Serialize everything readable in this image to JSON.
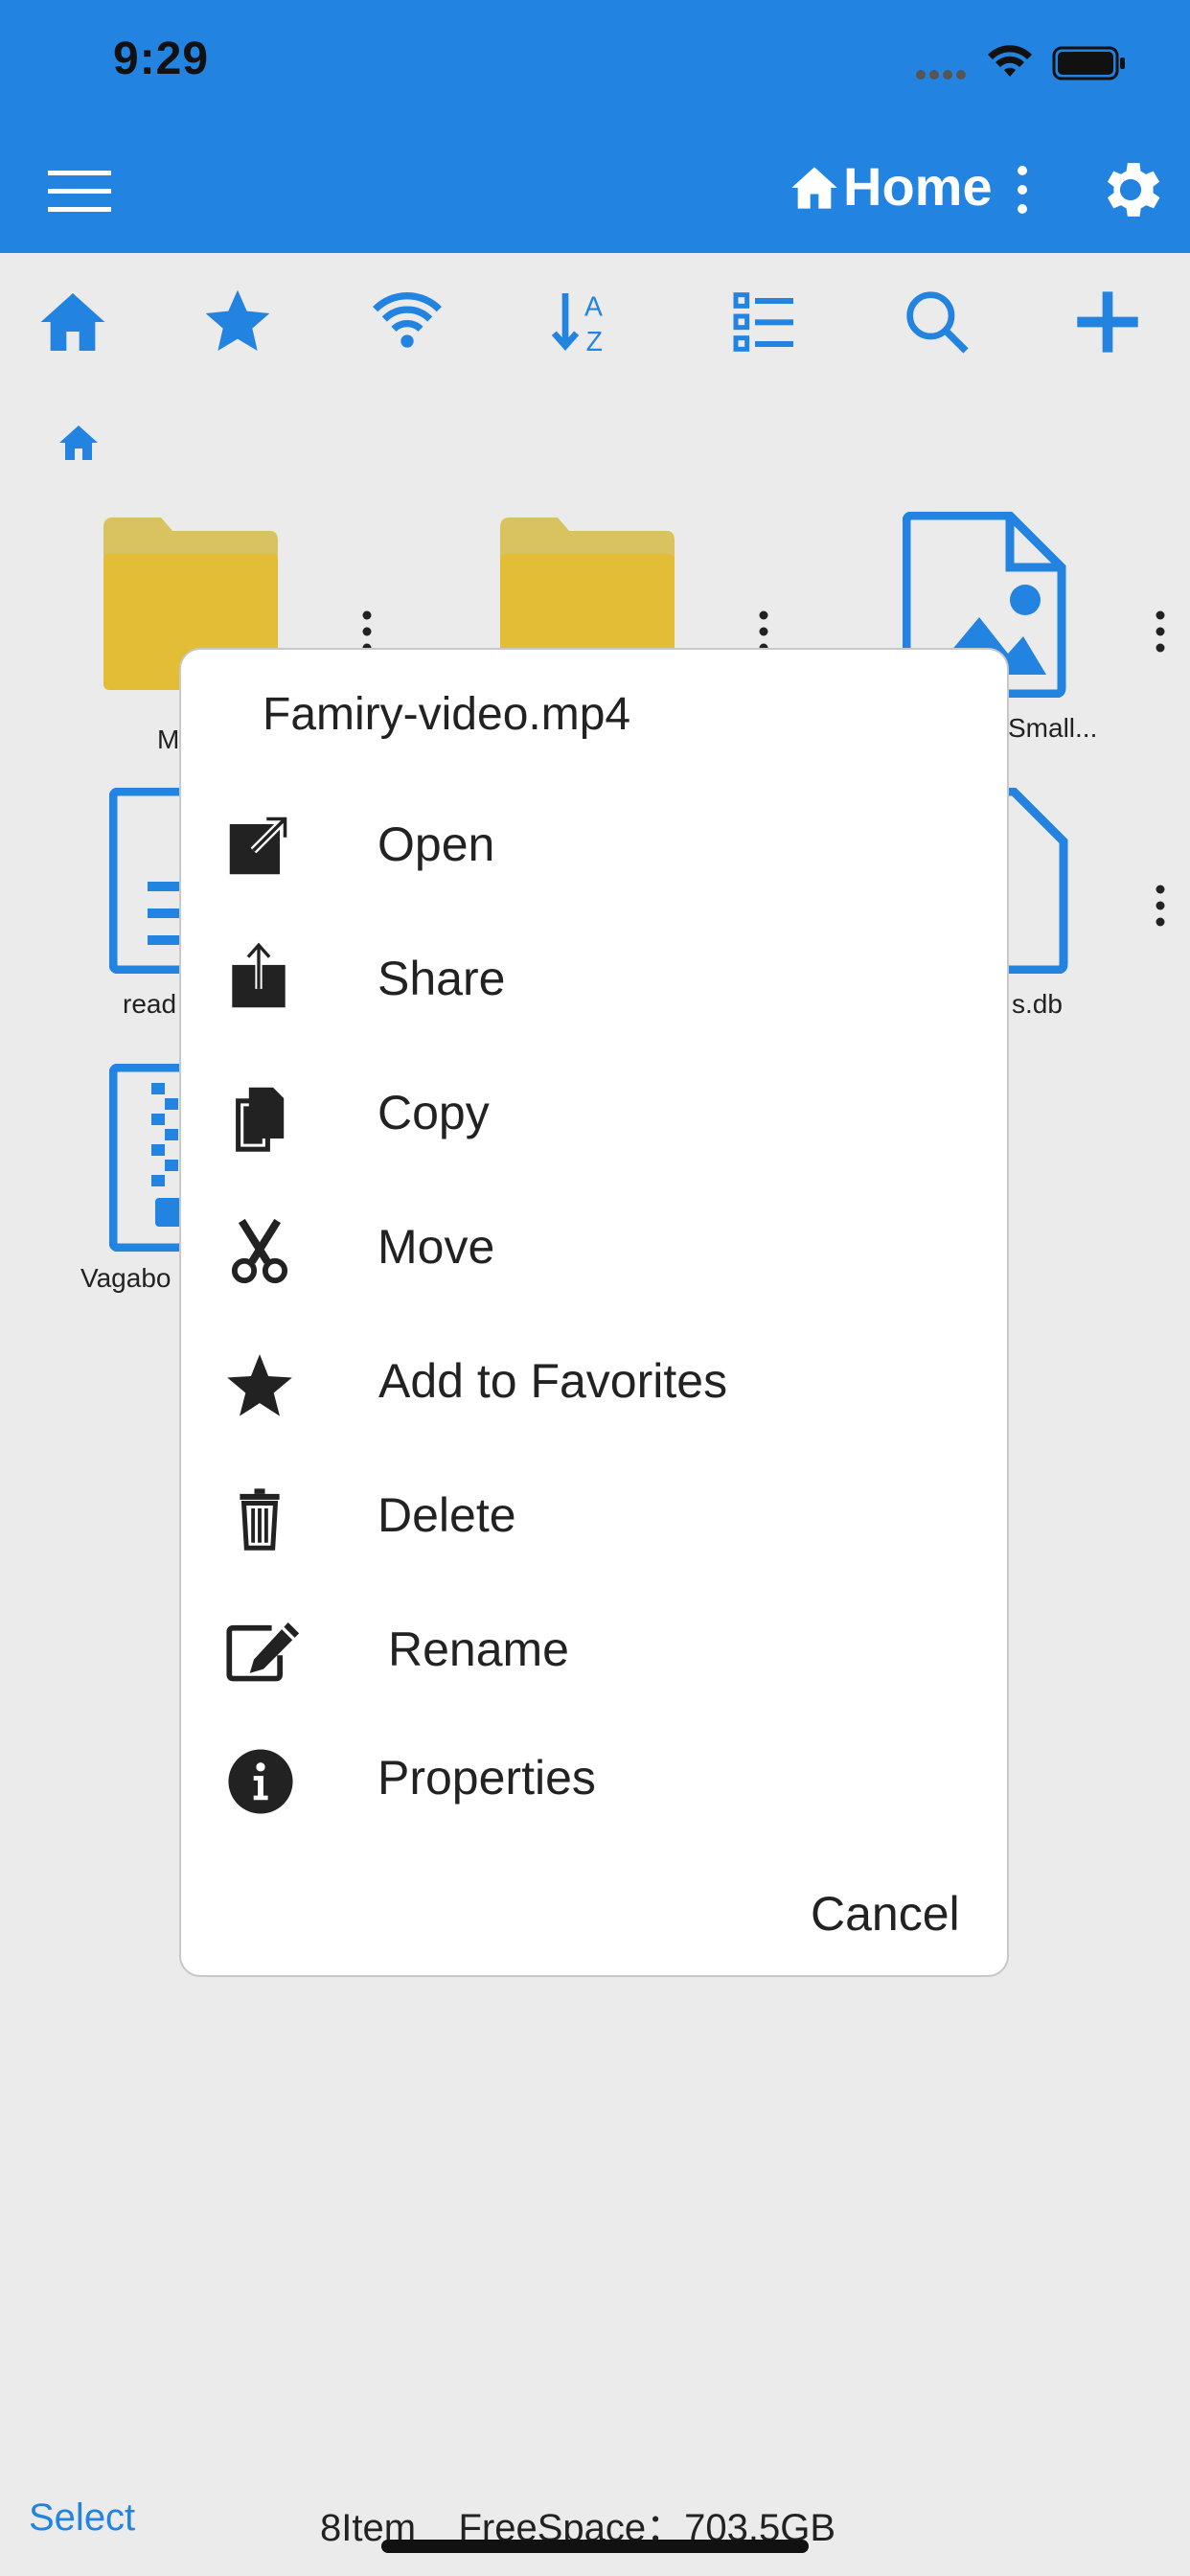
{
  "status": {
    "time": "9:29"
  },
  "header": {
    "title": "Home"
  },
  "toolbar": {
    "icons": [
      "home-icon",
      "star-icon",
      "wifi-icon",
      "sort-icon",
      "list-icon",
      "search-icon",
      "plus-icon"
    ]
  },
  "files": [
    {
      "label": "M"
    },
    {
      "label": "Small..."
    },
    {
      "label": "read"
    },
    {
      "label": "s.db"
    },
    {
      "label": "Vagabo"
    }
  ],
  "dialog": {
    "title": "Famiry-video.mp4",
    "items": [
      {
        "label": "Open",
        "icon": "open-external-icon"
      },
      {
        "label": "Share",
        "icon": "share-icon"
      },
      {
        "label": "Copy",
        "icon": "copy-icon"
      },
      {
        "label": "Move",
        "icon": "scissors-icon"
      },
      {
        "label": "Add to Favorites",
        "icon": "star-icon"
      },
      {
        "label": "Delete",
        "icon": "trash-icon"
      },
      {
        "label": "Rename",
        "icon": "edit-icon"
      },
      {
        "label": "Properties",
        "icon": "info-icon"
      }
    ],
    "cancel": "Cancel"
  },
  "footer": {
    "select": "Select",
    "info": "8Item    FreeSpace：703.5GB"
  },
  "colors": {
    "accent": "#2283e0",
    "folder": "#e0bf3a",
    "background": "#ebebeb"
  }
}
